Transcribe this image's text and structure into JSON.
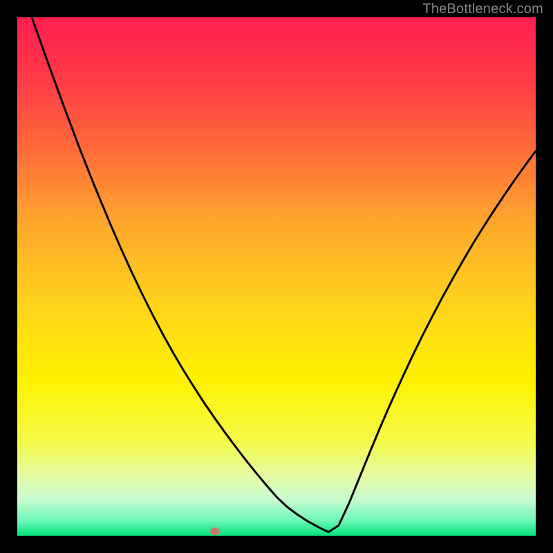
{
  "watermark": "TheBottleneck.com",
  "chart_data": {
    "type": "line",
    "title": "",
    "xlabel": "",
    "ylabel": "",
    "xlim": [
      0,
      1
    ],
    "ylim": [
      0,
      1
    ],
    "x": [
      0.0,
      0.02,
      0.04,
      0.06,
      0.08,
      0.1,
      0.12,
      0.14,
      0.16,
      0.18,
      0.2,
      0.22,
      0.24,
      0.26,
      0.28,
      0.3,
      0.32,
      0.34,
      0.36,
      0.38,
      0.4,
      0.42,
      0.44,
      0.46,
      0.48,
      0.5,
      0.52,
      0.54,
      0.56,
      0.58,
      0.6,
      0.62,
      0.64,
      0.66,
      0.68,
      0.7,
      0.72,
      0.74,
      0.76,
      0.78,
      0.8,
      0.82,
      0.84,
      0.86,
      0.88,
      0.9,
      0.92,
      0.94,
      0.96,
      0.98,
      1.0
    ],
    "y": [
      1.08,
      1.023,
      0.966,
      0.91,
      0.855,
      0.801,
      0.748,
      0.697,
      0.648,
      0.6,
      0.554,
      0.51,
      0.468,
      0.428,
      0.39,
      0.354,
      0.32,
      0.288,
      0.257,
      0.228,
      0.2,
      0.173,
      0.147,
      0.122,
      0.098,
      0.075,
      0.056,
      0.041,
      0.028,
      0.017,
      0.007,
      0.02,
      0.063,
      0.112,
      0.161,
      0.209,
      0.255,
      0.299,
      0.342,
      0.383,
      0.422,
      0.46,
      0.496,
      0.531,
      0.565,
      0.597,
      0.628,
      0.658,
      0.687,
      0.715,
      0.742
    ],
    "marker": {
      "x": 0.3815,
      "y": 0.0085
    },
    "gradient_stops": [
      {
        "pos": 0.0,
        "color": "#ff1f4f"
      },
      {
        "pos": 0.12,
        "color": "#ff3a47"
      },
      {
        "pos": 0.25,
        "color": "#ff6a3a"
      },
      {
        "pos": 0.4,
        "color": "#ffa82c"
      },
      {
        "pos": 0.55,
        "color": "#ffd21c"
      },
      {
        "pos": 0.7,
        "color": "#fff200"
      },
      {
        "pos": 0.82,
        "color": "#f4fa4a"
      },
      {
        "pos": 0.88,
        "color": "#e8fca0"
      },
      {
        "pos": 0.93,
        "color": "#c8fbd0"
      },
      {
        "pos": 0.97,
        "color": "#70f7b8"
      },
      {
        "pos": 1.0,
        "color": "#00e37b"
      }
    ],
    "notes": "x and y are in normalized 0–1 plot coordinates; no axis ticks or labels are rendered in the original image."
  }
}
